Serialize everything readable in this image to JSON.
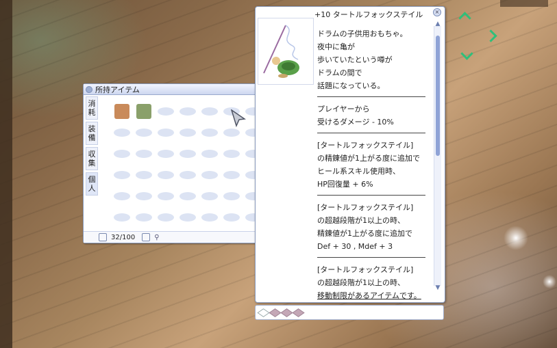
{
  "inventory": {
    "title": "所持アイテム",
    "tabs": [
      "消耗",
      "装備",
      "収集",
      "個人"
    ],
    "active_tab": "個人",
    "count": "32/100",
    "rows": 6,
    "cols": 7,
    "items": [
      {
        "name": "stove-icon",
        "color": "#c98a5a"
      },
      {
        "name": "cart-icon",
        "color": "#8aa06a"
      }
    ]
  },
  "item_desc": {
    "title": "+10 タートルフォックステイル",
    "lines": [
      {
        "t": "ドラムの子供用おもちゃ。"
      },
      {
        "t": "夜中に亀が"
      },
      {
        "t": "歩いていたという噂が"
      },
      {
        "t": "ドラムの間で"
      },
      {
        "t": "話題になっている。"
      },
      {
        "sep": true
      },
      {
        "t": "プレイヤーから"
      },
      {
        "t": "受けるダメージ - 10%"
      },
      {
        "sep": true
      },
      {
        "t": "[タートルフォックステイル]"
      },
      {
        "t": "の精錬値が1上がる度に追加で"
      },
      {
        "t": "ヒール系スキル使用時、"
      },
      {
        "t": "HP回復量 + 6%"
      },
      {
        "sep": true
      },
      {
        "t": "[タートルフォックステイル]"
      },
      {
        "t": "の超越段階が1以上の時、"
      },
      {
        "t": "精錬値が1上がる度に追加で"
      },
      {
        "t": "Def + 30 , Mdef + 3"
      },
      {
        "sep": true
      },
      {
        "t": "[タートルフォックステイル]"
      },
      {
        "t": "の超越段階が1以上の時、"
      },
      {
        "t": "移動制限があるアイテムです。",
        "u": true
      }
    ]
  },
  "card_slots": [
    {
      "filled": false
    },
    {
      "filled": true
    },
    {
      "filled": true
    },
    {
      "filled": true
    }
  ]
}
